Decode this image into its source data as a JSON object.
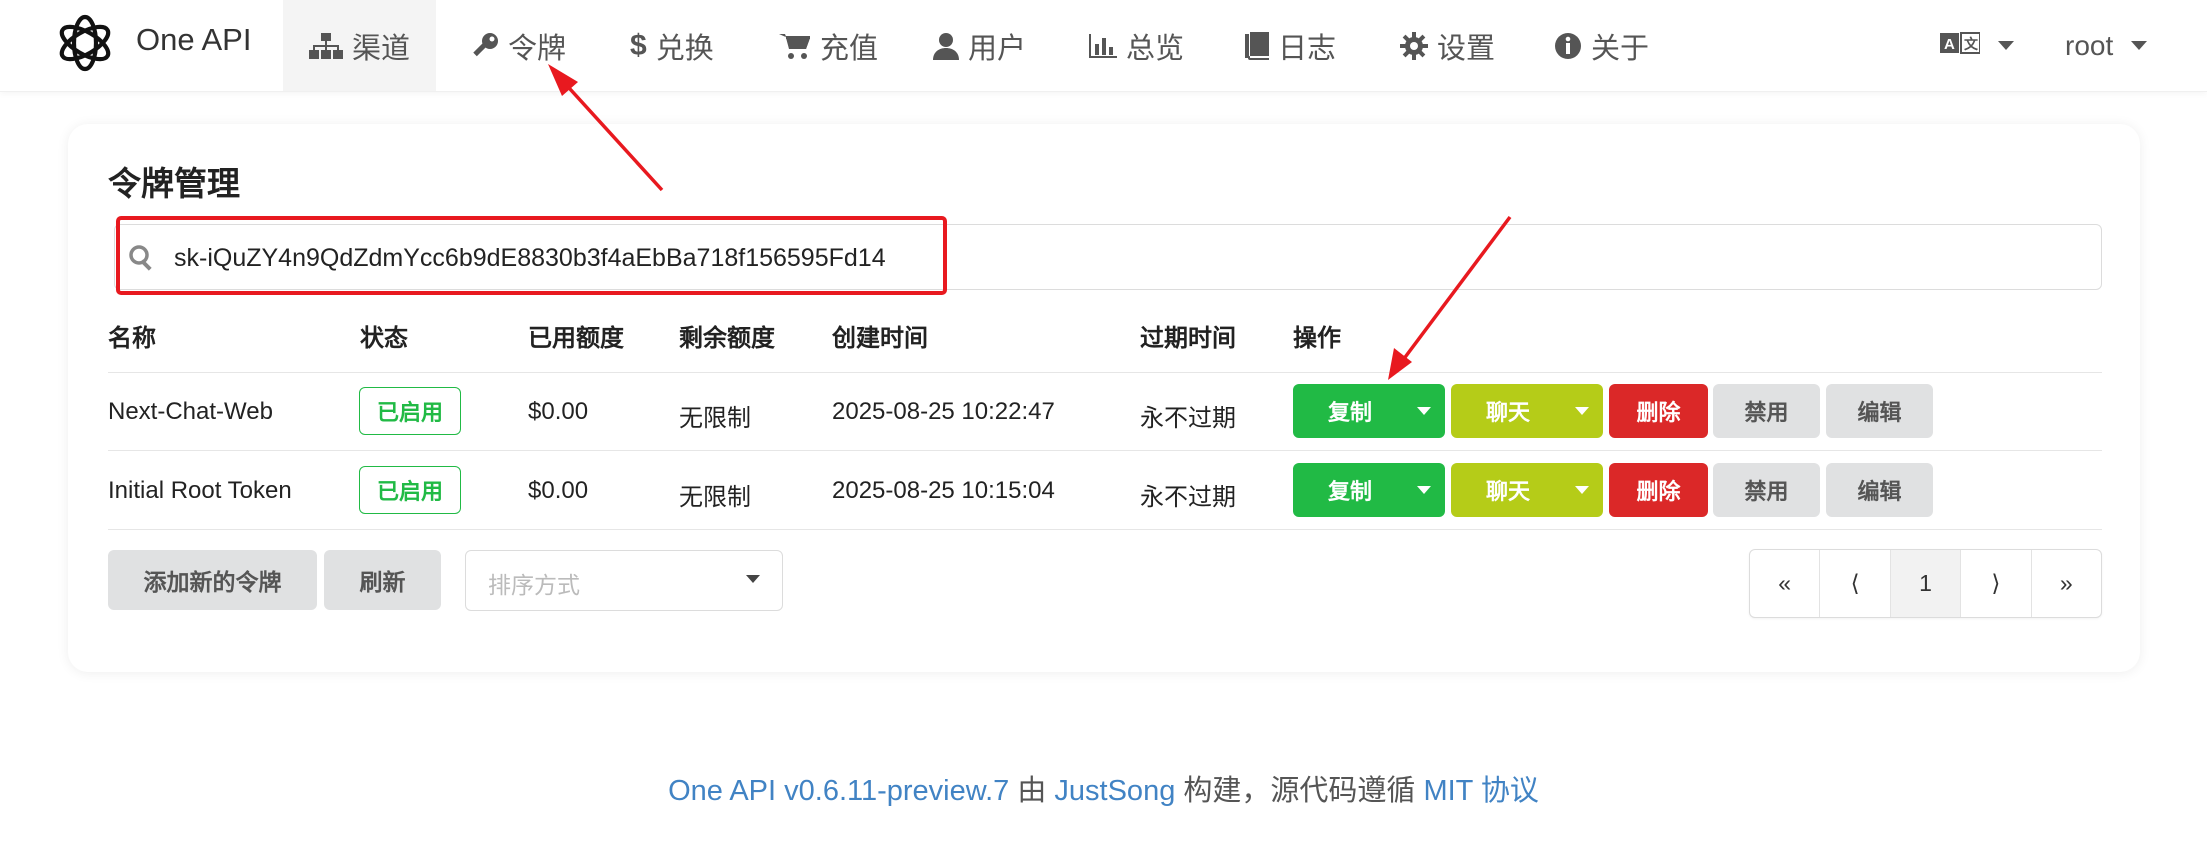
{
  "header": {
    "brand": "One API",
    "nav": [
      {
        "label": "渠道",
        "icon": "sitemap-icon"
      },
      {
        "label": "令牌",
        "icon": "key-icon"
      },
      {
        "label": "兑换",
        "icon": "dollar-icon"
      },
      {
        "label": "充值",
        "icon": "cart-icon"
      },
      {
        "label": "用户",
        "icon": "user-icon"
      },
      {
        "label": "总览",
        "icon": "bar-chart-icon"
      },
      {
        "label": "日志",
        "icon": "book-icon"
      },
      {
        "label": "设置",
        "icon": "gear-icon"
      },
      {
        "label": "关于",
        "icon": "info-icon"
      }
    ],
    "language_icon": "translate-icon",
    "user": "root"
  },
  "main": {
    "title": "令牌管理",
    "search_value": "sk-iQuZY4n9QdZdmYcc6b9dE8830b3f4aEbBa718f156595Fd14",
    "columns": [
      "名称",
      "状态",
      "已用额度",
      "剩余额度",
      "创建时间",
      "过期时间",
      "操作"
    ],
    "rows": [
      {
        "name": "Next-Chat-Web",
        "status": "已启用",
        "used": "$0.00",
        "remain": "无限制",
        "created": "2025-08-25 10:22:47",
        "expire": "永不过期"
      },
      {
        "name": "Initial Root Token",
        "status": "已启用",
        "used": "$0.00",
        "remain": "无限制",
        "created": "2025-08-25 10:15:04",
        "expire": "永不过期"
      }
    ],
    "actions": {
      "copy": "复制",
      "chat": "聊天",
      "delete": "删除",
      "disable": "禁用",
      "edit": "编辑"
    },
    "add_button": "添加新的令牌",
    "refresh_button": "刷新",
    "sort_placeholder": "排序方式",
    "pagination": [
      "«",
      "⟨",
      "1",
      "⟩",
      "»"
    ]
  },
  "footer": {
    "version_link": "One API v0.6.11-preview.7",
    "by": " 由 ",
    "author_link": "JustSong",
    "built": " 构建，源代码遵循 ",
    "license_link": "MIT 协议"
  },
  "colors": {
    "green": "#21ba45",
    "olive": "#b5cc18",
    "red": "#db2828",
    "grey": "#e0e1e2",
    "link": "#4183c4",
    "annotation": "#e8191f"
  }
}
